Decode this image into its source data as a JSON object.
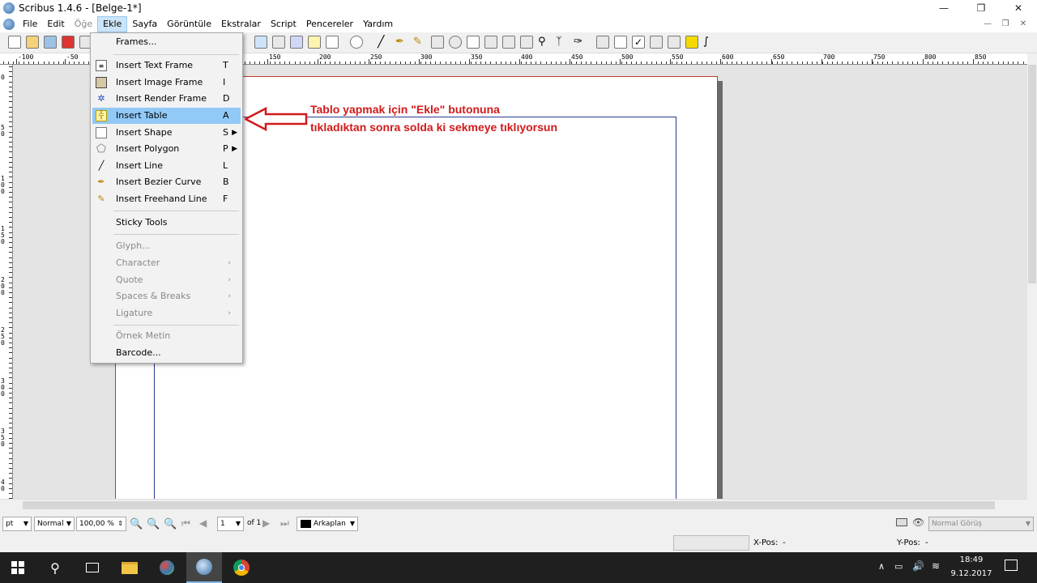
{
  "window": {
    "title": "Scribus 1.4.6 - [Belge-1*]",
    "minimize": "—",
    "maximize": "❐",
    "close": "✕"
  },
  "menubar": {
    "items": [
      {
        "label": "File"
      },
      {
        "label": "Edit"
      },
      {
        "label": "Öğe"
      },
      {
        "label": "Ekle"
      },
      {
        "label": "Sayfa"
      },
      {
        "label": "Görüntüle"
      },
      {
        "label": "Ekstralar"
      },
      {
        "label": "Script"
      },
      {
        "label": "Pencereler"
      },
      {
        "label": "Yardım"
      }
    ],
    "mdi_min": "—",
    "mdi_restore": "❐",
    "mdi_close": "✕"
  },
  "ruler": {
    "h_labels": [
      "-100",
      "-50",
      "150",
      "200",
      "250",
      "300",
      "350",
      "400",
      "450",
      "500",
      "550",
      "600",
      "650",
      "700",
      "750",
      "800",
      "850"
    ],
    "v_labels": [
      "0",
      "5 0",
      "1 0 0",
      "1 5 0",
      "2 0 0",
      "2 5 0",
      "3 0 0",
      "3 5 0",
      "4 0"
    ]
  },
  "ekle_menu": {
    "frames": "Frames...",
    "items": [
      {
        "label": "Insert Text Frame",
        "shortcut": "T",
        "icon": "text-frame-icon"
      },
      {
        "label": "Insert Image Frame",
        "shortcut": "I",
        "icon": "image-frame-icon"
      },
      {
        "label": "Insert Render Frame",
        "shortcut": "D",
        "icon": "render-frame-icon"
      },
      {
        "label": "Insert Table",
        "shortcut": "A",
        "icon": "table-icon"
      },
      {
        "label": "Insert Shape",
        "shortcut": "S",
        "icon": "shape-icon"
      },
      {
        "label": "Insert Polygon",
        "shortcut": "P",
        "icon": "polygon-icon"
      },
      {
        "label": "Insert Line",
        "shortcut": "L",
        "icon": "line-icon"
      },
      {
        "label": "Insert Bezier Curve",
        "shortcut": "B",
        "icon": "bezier-icon"
      },
      {
        "label": "Insert Freehand Line",
        "shortcut": "F",
        "icon": "pencil-icon"
      }
    ],
    "sticky": "Sticky Tools",
    "glyph": "Glyph...",
    "character": "Character",
    "quote": "Quote",
    "spaces": "Spaces & Breaks",
    "ligature": "Ligature",
    "sample": "Örnek Metin",
    "barcode": "Barcode..."
  },
  "annotation": {
    "line1": "Tablo yapmak için \"Ekle\" butonuna",
    "line2": "tıkladıktan sonra solda ki sekmeye tıklıyorsun",
    "color": "#d11a1a"
  },
  "statusbar": {
    "unit": "pt",
    "mode": "Normal",
    "zoom": "100,00 %",
    "page": "1",
    "page_of": "of 1",
    "layer": "Arkaplan",
    "view_mode": "Normal Görüş"
  },
  "coords": {
    "xpos_label": "X-Pos:",
    "xpos_value": "-",
    "ypos_label": "Y-Pos:",
    "ypos_value": "-"
  },
  "taskbar": {
    "time": "18:49",
    "date": "9.12.2017"
  }
}
